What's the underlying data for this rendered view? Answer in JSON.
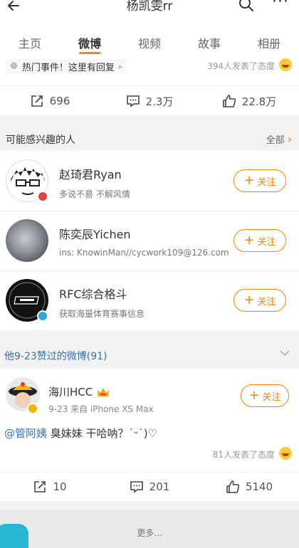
{
  "header": {
    "title": "杨凯雯rr",
    "icons": [
      "back-icon",
      "search-icon",
      "more-icon"
    ],
    "more_glyph": "···"
  },
  "tabs": [
    {
      "label": "主页",
      "active": false
    },
    {
      "label": "微博",
      "active": true
    },
    {
      "label": "视频",
      "active": false
    },
    {
      "label": "故事",
      "active": false
    },
    {
      "label": "相册",
      "active": false
    }
  ],
  "first_post": {
    "topic": "热门事件！这里有回复",
    "reaction_text": "394人发表了态度",
    "actions": {
      "repost": "696",
      "comment": "2.3万",
      "like": "22.8万"
    }
  },
  "suggestions": {
    "title": "可能感兴趣的人",
    "all_label": "全部",
    "follow_label": "关注",
    "users": [
      {
        "name": "赵琦君Ryan",
        "desc": "多说不易 不解风情",
        "badge_color": "#e8403b"
      },
      {
        "name": "陈奕辰Yichen",
        "desc": "ins: KnowinMan//cycwork109@126.com",
        "badge_color": ""
      },
      {
        "name": "RFC综合格斗",
        "desc": "获取海量体育赛事信息",
        "badge_color": "#2ea7e0"
      }
    ]
  },
  "liked_section": {
    "title": "他9-23赞过的微博(91)"
  },
  "liked_post": {
    "author": "海川HCC",
    "date": "9-23",
    "source": "来自 iPhone XS Max",
    "mention": "@管阿姨",
    "text": " 臭妹妹 干哈呐？˙ᵕ˙)♡",
    "reaction_text": "81人发表了态度",
    "follow_label": "关注",
    "actions": {
      "repost": "10",
      "comment": "201",
      "like": "5140"
    }
  },
  "footer": {
    "more_label": "更多..."
  },
  "colors": {
    "accent": "#ff8200",
    "link": "#3a6fb0",
    "background": "#f2f2f2"
  }
}
